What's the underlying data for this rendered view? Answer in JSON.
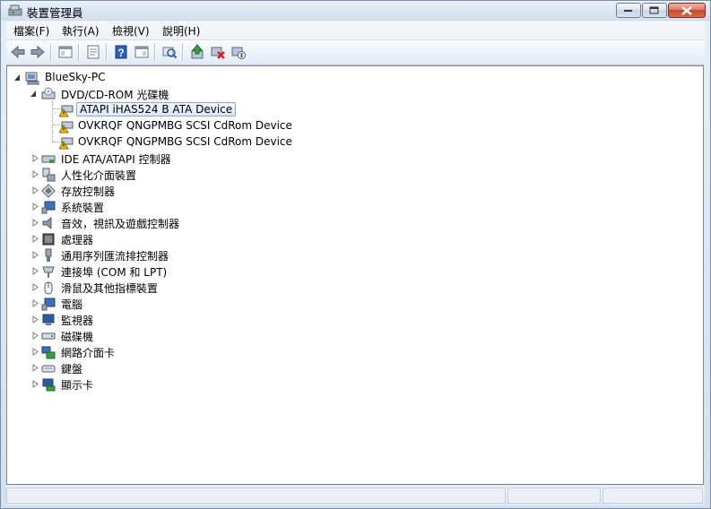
{
  "window": {
    "title": "裝置管理員"
  },
  "menu": [
    "檔案(F)",
    "執行(A)",
    "檢視(V)",
    "說明(H)"
  ],
  "toolbar": {
    "icons": [
      "back-arrow-icon",
      "forward-arrow-icon",
      "show-hide-tree-icon",
      "properties-icon",
      "help-icon",
      "action-pane-icon",
      "scan-hardware-icon",
      "update-driver-icon",
      "uninstall-device-icon",
      "disable-device-icon"
    ]
  },
  "tree": {
    "root": "BlueSky-PC",
    "dvd_group": "DVD/CD-ROM 光碟機",
    "dvd_devices": [
      "ATAPI iHAS524   B ATA Device",
      "OVKRQF QNGPMBG SCSI CdRom Device",
      "OVKRQF QNGPMBG SCSI CdRom Device"
    ],
    "categories": [
      "IDE ATA/ATAPI 控制器",
      "人性化介面裝置",
      "存放控制器",
      "系統裝置",
      "音效，視訊及遊戲控制器",
      "處理器",
      "通用序列匯流排控制器",
      "連接埠 (COM 和 LPT)",
      "滑鼠及其他指標裝置",
      "電腦",
      "監視器",
      "磁碟機",
      "網路介面卡",
      "鍵盤",
      "顯示卡"
    ]
  },
  "colors": {
    "selection_border": "#84acdd",
    "warning_yellow": "#f2c200"
  }
}
